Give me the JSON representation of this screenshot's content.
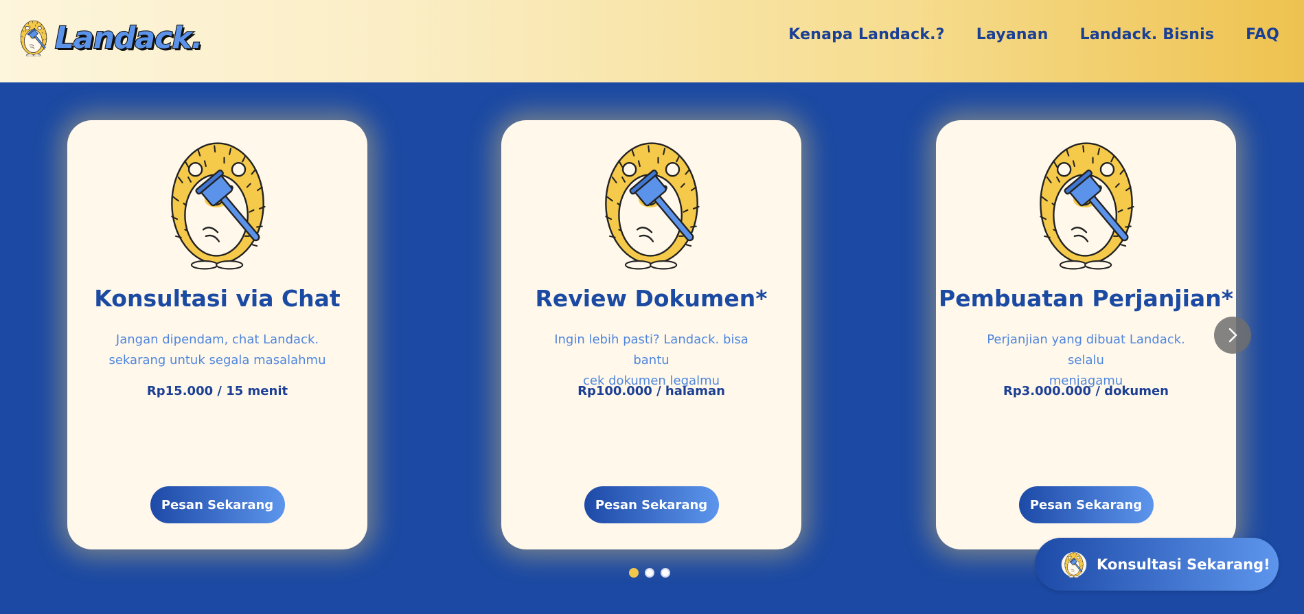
{
  "header": {
    "logo_text": "Landack.",
    "nav": [
      "Kenapa Landack.?",
      "Layanan",
      "Landack. Bisnis",
      "FAQ"
    ]
  },
  "cards": [
    {
      "title": "Konsultasi via Chat",
      "desc_line1": "Jangan dipendam, chat Landack.",
      "desc_line2": "sekarang untuk segala masalahmu",
      "price": "Rp15.000 / 15 menit",
      "button": "Pesan Sekarang"
    },
    {
      "title": "Review Dokumen*",
      "desc_line1": "Ingin lebih pasti? Landack. bisa bantu",
      "desc_line2": "cek dokumen legalmu",
      "price": "Rp100.000 / halaman",
      "button": "Pesan Sekarang"
    },
    {
      "title": "Pembuatan Perjanjian*",
      "desc_line1": "Perjanjian yang dibuat Landack. selalu",
      "desc_line2": "menjagamu",
      "price": "Rp3.000.000 / dokumen",
      "button": "Pesan Sekarang"
    }
  ],
  "carousel": {
    "slide_count": 3,
    "active_index": 0
  },
  "cta": {
    "label": "Konsultasi Sekarang!"
  },
  "colors": {
    "primary_blue": "#1b49a3",
    "accent_yellow": "#f3c84a",
    "card_bg": "#fff8eb",
    "light_blue": "#5d95ec"
  },
  "icons": [
    "hedgehog-logo-icon",
    "hedgehog-mascot-icon",
    "gavel-icon",
    "chevron-right-icon"
  ]
}
